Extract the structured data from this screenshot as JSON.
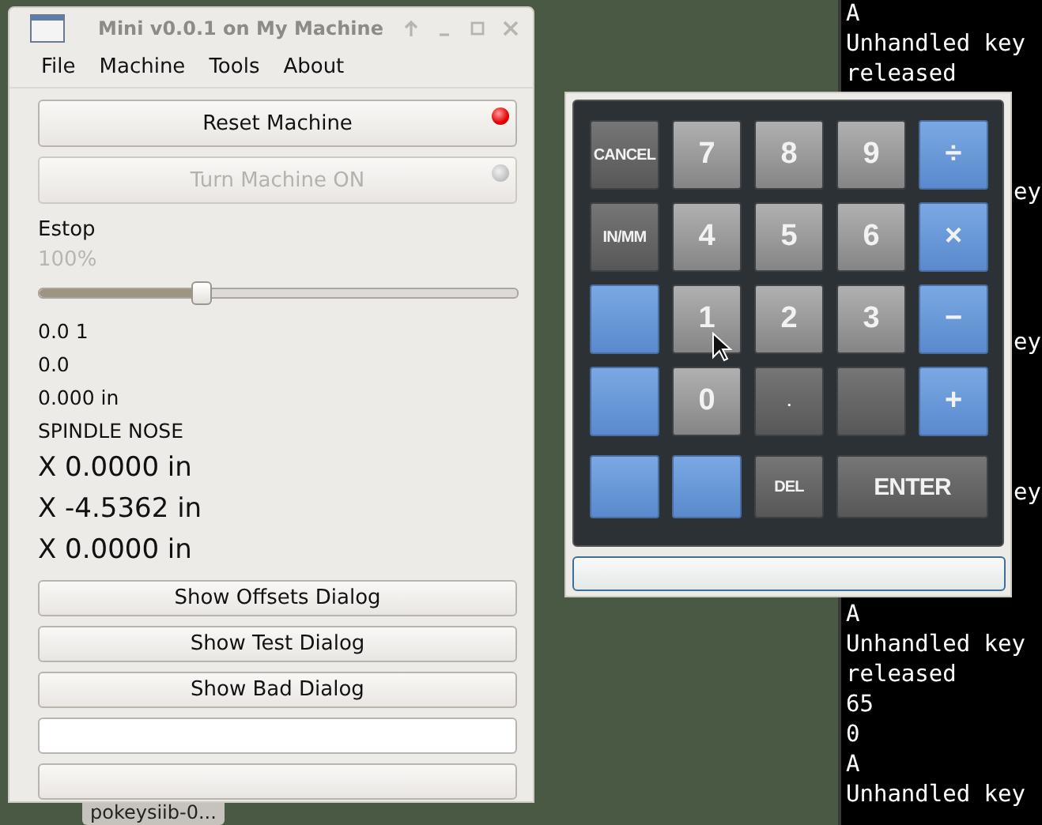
{
  "main_window": {
    "title": "Mini v0.0.1 on My Machine",
    "menu": [
      {
        "label": "File"
      },
      {
        "label": "Machine"
      },
      {
        "label": "Tools"
      },
      {
        "label": "About"
      }
    ],
    "buttons": [
      {
        "label": "Reset Machine",
        "disabled": false,
        "lit": true
      },
      {
        "label": "Turn Machine ON",
        "disabled": true,
        "lit": false
      }
    ],
    "estop_label": "Estop",
    "feed": {
      "reading": "100%",
      "disabled": true,
      "level": 0.34
    },
    "readouts": [
      {
        "text": "0.0 1",
        "kind": "small"
      },
      {
        "text": "0.0",
        "kind": "small"
      },
      {
        "text": "0.000 in",
        "kind": "small"
      },
      {
        "text": "SPINDLE NOSE",
        "kind": "small"
      },
      {
        "text": "X 0.0000 in",
        "kind": "large"
      },
      {
        "text": "X -4.5362 in",
        "kind": "large"
      },
      {
        "text": "X 0.0000 in",
        "kind": "large"
      }
    ],
    "dialog_buttons": [
      "Show Offsets Dialog",
      "Show Test Dialog",
      "Show Bad Dialog"
    ],
    "bottom_widgets": [
      {
        "kind": "input"
      },
      {
        "kind": "button"
      }
    ]
  },
  "taskbar_item": "pokeysiib-0...",
  "keypad": {
    "keys": [
      {
        "label": "CANCEL",
        "kind": "dark"
      },
      {
        "label": "7",
        "kind": "gray"
      },
      {
        "label": "8",
        "kind": "gray"
      },
      {
        "label": "9",
        "kind": "gray"
      },
      {
        "label": "÷",
        "kind": "blue"
      },
      {
        "label": "IN/MM",
        "kind": "dark"
      },
      {
        "label": "4",
        "kind": "gray"
      },
      {
        "label": "5",
        "kind": "gray"
      },
      {
        "label": "6",
        "kind": "gray"
      },
      {
        "label": "×",
        "kind": "blue"
      },
      {
        "kind": "blue"
      },
      {
        "label": "1",
        "kind": "gray"
      },
      {
        "label": "2",
        "kind": "gray"
      },
      {
        "label": "3",
        "kind": "gray"
      },
      {
        "label": "−",
        "kind": "blue"
      },
      {
        "kind": "blue"
      },
      {
        "label": "0",
        "kind": "gray"
      },
      {
        "label": ".",
        "kind": "dark"
      },
      {
        "kind": "dark"
      },
      {
        "label": "+",
        "kind": "blue"
      },
      {
        "kind": "blue"
      },
      {
        "kind": "blue"
      },
      {
        "label": "DEL",
        "kind": "dark"
      },
      {
        "label": "ENTER",
        "kind": "dark-wide"
      }
    ]
  },
  "terminal": {
    "top_lines": [
      "A",
      "Unhandled key",
      "released"
    ],
    "tails": [
      "ey",
      "ey",
      "ey"
    ],
    "bottom_lines": [
      "A",
      "Unhandled key",
      "released",
      "65",
      "0",
      "A",
      "Unhandled key"
    ]
  }
}
